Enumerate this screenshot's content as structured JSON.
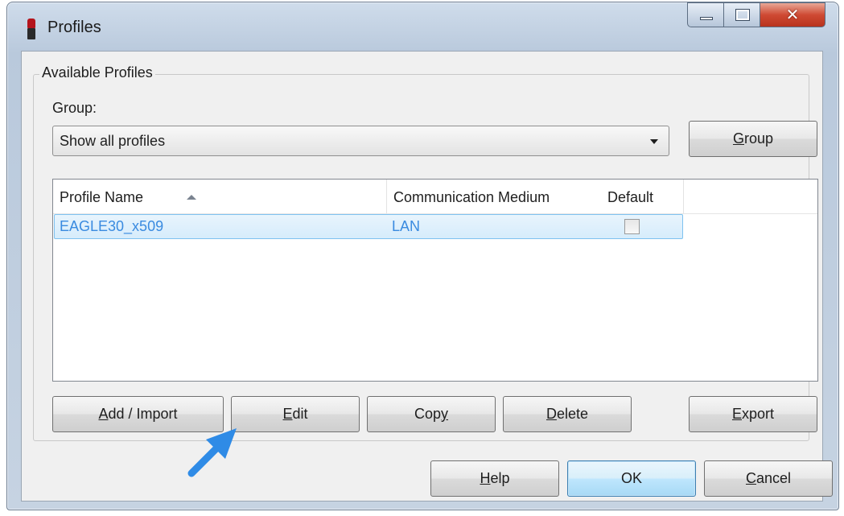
{
  "window": {
    "title": "Profiles",
    "controls": {
      "minimize": "minimize-icon",
      "maximize": "maximize-icon",
      "close": "close-icon"
    }
  },
  "group_box": {
    "legend": "Available Profiles"
  },
  "group_field": {
    "label": "Group:",
    "selected": "Show all profiles"
  },
  "buttons": {
    "group": {
      "mnemonic": "G",
      "rest": "roup"
    },
    "add_import": {
      "mnemonic": "A",
      "rest": "dd / Import"
    },
    "edit": {
      "mnemonic": "E",
      "rest": "dit"
    },
    "copy": {
      "pre": "Cop",
      "mnemonic": "y"
    },
    "delete": {
      "mnemonic": "D",
      "rest": "elete"
    },
    "export": {
      "mnemonic": "E",
      "rest": "xport"
    },
    "help": {
      "mnemonic": "H",
      "rest": "elp"
    },
    "ok": {
      "label": "OK"
    },
    "cancel": {
      "mnemonic": "C",
      "rest": "ancel"
    }
  },
  "profiles_table": {
    "columns": [
      "Profile Name",
      "Communication Medium",
      "Default"
    ],
    "sort": {
      "column": "Profile Name",
      "direction": "ascending"
    },
    "rows": [
      {
        "profile_name": "EAGLE30_x509",
        "medium": "LAN",
        "default": false,
        "selected": true
      }
    ]
  },
  "colors": {
    "selection_text": "#3a8be0",
    "selection_border": "#7fc2f0",
    "hint_arrow": "#2f8be6"
  }
}
